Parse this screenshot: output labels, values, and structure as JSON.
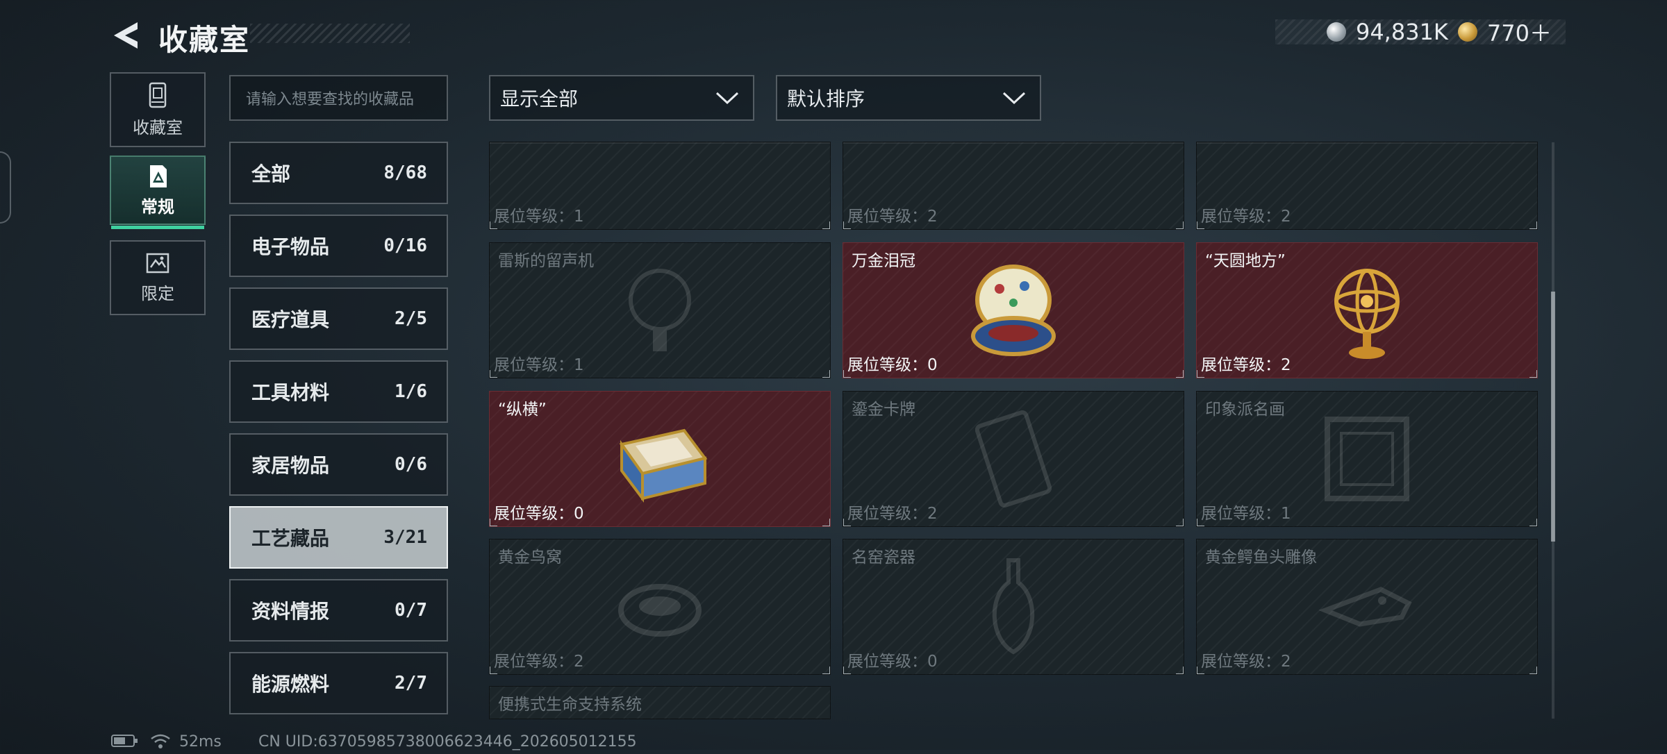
{
  "header": {
    "title": "收藏室",
    "currencies": [
      {
        "icon": "silver-coin-icon",
        "value": "94,831K"
      },
      {
        "icon": "gold-coin-icon",
        "value": "770＋"
      }
    ]
  },
  "tabs": [
    {
      "label": "收藏室",
      "icon": "display-case-icon",
      "active": false
    },
    {
      "label": "常规",
      "icon": "card-badge-icon",
      "active": true
    },
    {
      "label": "限定",
      "icon": "scroll-map-icon",
      "active": false
    }
  ],
  "search": {
    "placeholder": "请输入想要查找的收藏品"
  },
  "categories": [
    {
      "name": "全部",
      "count": "8/68"
    },
    {
      "name": "电子物品",
      "count": "0/16"
    },
    {
      "name": "医疗道具",
      "count": "2/5"
    },
    {
      "name": "工具材料",
      "count": "1/6"
    },
    {
      "name": "家居物品",
      "count": "0/6"
    },
    {
      "name": "工艺藏品",
      "count": "3/21",
      "active": true
    },
    {
      "name": "资料情报",
      "count": "0/7"
    },
    {
      "name": "能源燃料",
      "count": "2/7"
    }
  ],
  "filters": {
    "display": "显示全部",
    "sort": "默认排序"
  },
  "items": [
    {
      "name": "",
      "level": "展位等级：1",
      "owned": false
    },
    {
      "name": "",
      "level": "展位等级：2",
      "owned": false
    },
    {
      "name": "",
      "level": "展位等级：2",
      "owned": false
    },
    {
      "name": "雷斯的留声机",
      "level": "展位等级：1",
      "owned": false
    },
    {
      "name": "万金泪冠",
      "level": "展位等级：0",
      "owned": true
    },
    {
      "name": "“天圆地方”",
      "level": "展位等级：2",
      "owned": true
    },
    {
      "name": "“纵横”",
      "level": "展位等级：0",
      "owned": true
    },
    {
      "name": "鎏金卡牌",
      "level": "展位等级：2",
      "owned": false
    },
    {
      "name": "印象派名画",
      "level": "展位等级：1",
      "owned": false
    },
    {
      "name": "黄金鸟窝",
      "level": "展位等级：2",
      "owned": false
    },
    {
      "name": "名窑瓷器",
      "level": "展位等级：0",
      "owned": false
    },
    {
      "name": "黄金鳄鱼头雕像",
      "level": "展位等级：2",
      "owned": false
    },
    {
      "name": "便携式生命支持系统",
      "level": "",
      "owned": false
    }
  ],
  "status_bar": {
    "ping": "52ms",
    "uid": "CN UID:63705985738006623446_202605012155"
  },
  "colors": {
    "owned_card": "#4a1f26",
    "active_tab_accent": "#3fd1a0",
    "card_base": "#1c2529"
  }
}
